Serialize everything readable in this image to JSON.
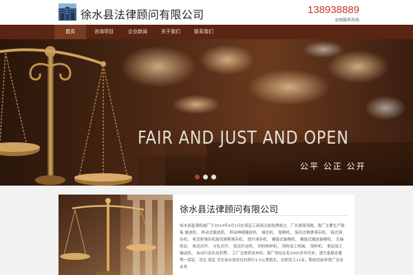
{
  "header": {
    "site_name": "徐水县法律顾问有限公司",
    "phone": "138938889",
    "hotline_label": "全国服务热线",
    "logo_icon": "building-logo-icon"
  },
  "nav": {
    "items": [
      {
        "label": "首页",
        "active": true
      },
      {
        "label": "咨询项目",
        "active": false
      },
      {
        "label": "企业新闻",
        "active": false
      },
      {
        "label": "关于我们",
        "active": false
      },
      {
        "label": "联系我们",
        "active": false
      }
    ]
  },
  "banner": {
    "headline": "FAIR AND JUST AND OPEN",
    "subheadline": "公平 公正 公开",
    "image": "scales-of-justice-image",
    "slide_count": 3,
    "active_slide": 1
  },
  "about": {
    "title": "徐水县法律顾问有限公司",
    "image": "scales-of-justice-photo",
    "body": "徐水县星满机械厂于2014年9月1日在保定工商局注册挂牌成立，厂长是周海霞，我厂主要生产销售 输送机、 移动式输送机、 移动伸缩输送机、 储仓机、 抛粮机、 旋风式粮食清杂机、 链式清杂机、 吸泥射清杂机旋风清粮清杂机、 提升清杂机、 螺旋式装粮机、 螺旋式输送装粮机、 无轴吸泥、 吸泥对开、 冷轧对开、 链式扒谷机、 饲料粉碎机、 饲料加工机械、 饲料机、 食品加工输送机、 自动行走扒谷机等， 工厂注册资本未知，我厂地址在有3000多年历史，涌为富泉忠番雩一保定，河北 保定 河北徐水县安住村西行1.5公里路北，在职员工11名，期待您前来我厂洽谈业务"
  },
  "colors": {
    "nav_bg": "#5a2512",
    "nav_active": "#7a3a1f",
    "accent_red": "#c0392b",
    "content_bg": "#f2f2f2"
  }
}
